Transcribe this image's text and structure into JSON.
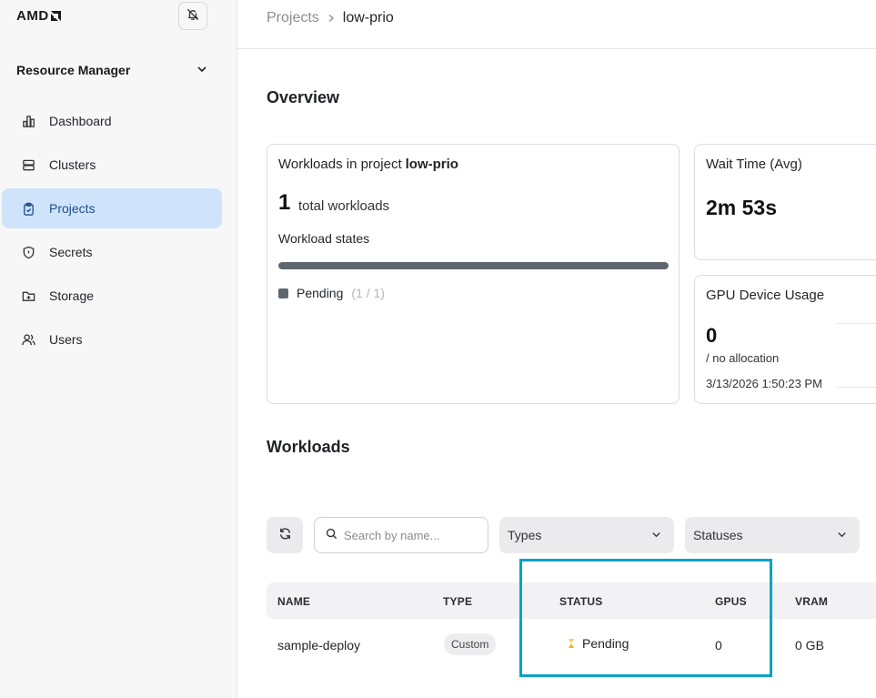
{
  "brand": {
    "logo_text": "AMD"
  },
  "sidebar": {
    "section_title": "Resource Manager",
    "items": [
      {
        "label": "Dashboard",
        "icon": "bar-chart-icon"
      },
      {
        "label": "Clusters",
        "icon": "server-icon"
      },
      {
        "label": "Projects",
        "icon": "clipboard-icon",
        "active": true
      },
      {
        "label": "Secrets",
        "icon": "shield-icon"
      },
      {
        "label": "Storage",
        "icon": "folder-icon"
      },
      {
        "label": "Users",
        "icon": "users-icon"
      }
    ]
  },
  "breadcrumb": {
    "parent": "Projects",
    "current": "low-prio"
  },
  "overview": {
    "heading": "Overview",
    "workloads_card": {
      "title_prefix": "Workloads in project",
      "project": "low-prio",
      "total": "1",
      "total_label": "total workloads",
      "states_label": "Workload states",
      "states": [
        {
          "name": "Pending",
          "count": "(1 / 1)",
          "fraction": 1.0,
          "color": "#5f6670"
        }
      ]
    },
    "wait_card": {
      "title": "Wait Time (Avg)",
      "value": "2m 53s"
    },
    "gpu_card": {
      "title": "GPU Device Usage",
      "value": "0",
      "sub": "/ no allocation",
      "timestamp": "3/13/2026 1:50:23 PM"
    }
  },
  "workloads": {
    "heading": "Workloads",
    "search_placeholder": "Search by name...",
    "types_label": "Types",
    "statuses_label": "Statuses",
    "columns": [
      "NAME",
      "TYPE",
      "STATUS",
      "GPUS",
      "VRAM"
    ],
    "rows": [
      {
        "name": "sample-deploy",
        "type": "Custom",
        "status": "Pending",
        "gpus": "0",
        "vram": "0 GB"
      }
    ]
  },
  "colors": {
    "active_nav_bg": "#cfe4fb",
    "highlight": "#0aa1c4",
    "pending": "#f0b429"
  }
}
